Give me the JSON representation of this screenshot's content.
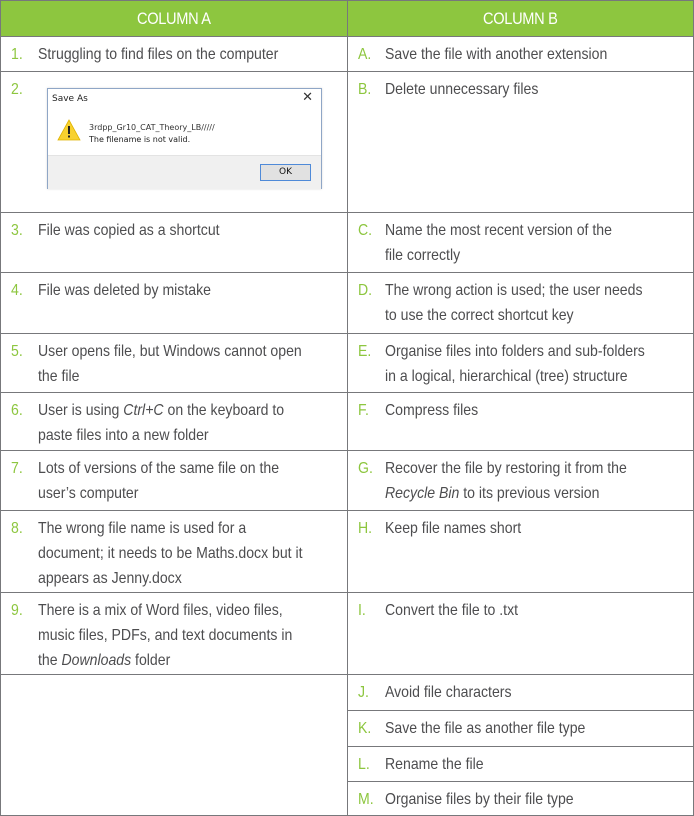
{
  "colors": {
    "accent_green": "#8dc63f",
    "body_text": "#4d4d4f",
    "border": "#77787b"
  },
  "headers": {
    "column_a": "COLUMN A",
    "column_b": "COLUMN B"
  },
  "column_a": [
    {
      "num": "1.",
      "text": "Struggling to find files on the computer"
    },
    {
      "num": "2.",
      "text": ""
    },
    {
      "num": "3.",
      "text": "File was copied as a shortcut"
    },
    {
      "num": "4.",
      "text": "File was deleted by mistake"
    },
    {
      "num": "5.",
      "text": "User opens file, but Windows cannot open the file"
    },
    {
      "num": "6.",
      "text_before": "User is using ",
      "text_italic": "Ctrl+C",
      "text_after": " on the keyboard to paste files into a new folder"
    },
    {
      "num": "7.",
      "text": "Lots of versions of the same file on the user’s computer"
    },
    {
      "num": "8.",
      "text": "The wrong file name is used for a document; it needs to be Maths.docx but it appears as Jenny.docx"
    },
    {
      "num": "9.",
      "text_before": "There is a mix of Word files, video files, music files, PDFs, and text documents in the ",
      "text_italic": "Downloads",
      "text_after": " folder"
    }
  ],
  "column_b": [
    {
      "num": "A.",
      "text": "Save the file with another extension"
    },
    {
      "num": "B.",
      "text": "Delete unnecessary files"
    },
    {
      "num": "C.",
      "text": "Name the most recent version of the file correctly"
    },
    {
      "num": "D.",
      "text": "The wrong action is used; the user needs to use the correct shortcut key"
    },
    {
      "num": "E.",
      "text": "Organise files into folders and sub-folders in a logical, hierarchical (tree) structure"
    },
    {
      "num": "F.",
      "text": "Compress files"
    },
    {
      "num": "G.",
      "text_before": "",
      "text_italic": "Recycle Bin",
      "text_after": " to its previous version",
      "text_lead": "Recover the file by restoring it from the "
    },
    {
      "num": "H.",
      "text": "Keep file names short"
    },
    {
      "num": "I.",
      "text": "Convert the file to .txt"
    },
    {
      "num": "J.",
      "text": "Avoid file characters"
    },
    {
      "num": "K.",
      "text": "Save the file as another file type"
    },
    {
      "num": "L.",
      "text": "Rename the file"
    },
    {
      "num": "M.",
      "text": "Organise files by their file type"
    }
  ],
  "dialog": {
    "title": "Save As",
    "close_icon": "close-icon",
    "warning_icon": "warning-icon",
    "message_line1": "3rdpp_Gr10_CAT_Theory_LB/////",
    "message_line2": "The filename is not valid.",
    "ok_label": "OK"
  }
}
